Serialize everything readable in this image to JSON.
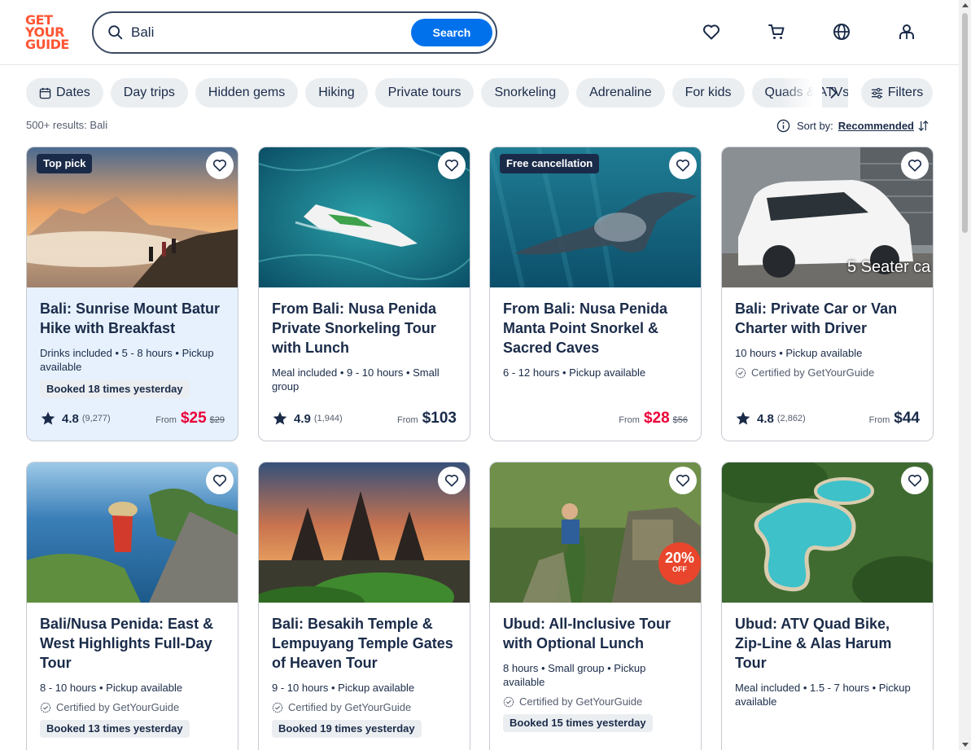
{
  "header": {
    "logo_lines": [
      "GET",
      "YOUR",
      "GUIDE"
    ],
    "search_value": "Bali",
    "search_button": "Search",
    "icons": [
      "heart-icon",
      "cart-icon",
      "globe-icon",
      "account-icon"
    ]
  },
  "chips": [
    {
      "label": "Dates",
      "icon": "calendar-icon"
    },
    {
      "label": "Day trips"
    },
    {
      "label": "Hidden gems"
    },
    {
      "label": "Hiking"
    },
    {
      "label": "Private tours"
    },
    {
      "label": "Snorkeling"
    },
    {
      "label": "Adrenaline"
    },
    {
      "label": "For kids"
    },
    {
      "label": "Quads & ATVs"
    }
  ],
  "filters_label": "Filters",
  "results_text": "500+ results: Bali",
  "sort": {
    "label": "Sort by:",
    "value": "Recommended"
  },
  "cards": [
    {
      "tag": "Top pick",
      "title": "Bali: Sunrise Mount Batur Hike with Breakfast",
      "meta": "Drinks included • 5 - 8 hours • Pickup available",
      "booked": "Booked 18 times yesterday",
      "rating": "4.8",
      "count": "(9,277)",
      "from": "From",
      "price": "$25",
      "old_price": "$29"
    },
    {
      "title": "From Bali: Nusa Penida Private Snorkeling Tour with Lunch",
      "meta": "Meal included • 9 - 10 hours • Small group",
      "rating": "4.9",
      "count": "(1,944)",
      "from": "From",
      "price": "$103"
    },
    {
      "tag": "Free cancellation",
      "title": "From Bali: Nusa Penida Manta Point Snorkel & Sacred Caves",
      "meta": "6 - 12 hours • Pickup available",
      "from": "From",
      "price": "$28",
      "old_price": "$56"
    },
    {
      "title": "Bali: Private Car or Van Charter with Driver",
      "meta": "10 hours • Pickup available",
      "cert": "Certified by GetYourGuide",
      "image_text": "5 Seater ca",
      "rating": "4.8",
      "count": "(2,862)",
      "from": "From",
      "price": "$44"
    },
    {
      "title": "Bali/Nusa Penida: East & West Highlights Full-Day Tour",
      "meta": "8 - 10 hours • Pickup available",
      "cert": "Certified by GetYourGuide",
      "booked": "Booked 13 times yesterday"
    },
    {
      "title": "Bali: Besakih Temple & Lempuyang Temple Gates of Heaven Tour",
      "meta": "9 - 10 hours • Pickup available",
      "cert": "Certified by GetYourGuide",
      "booked": "Booked 19 times yesterday"
    },
    {
      "title": "Ubud: All-Inclusive Tour with Optional Lunch",
      "meta": "8 hours • Small group • Pickup available",
      "cert": "Certified by GetYourGuide",
      "booked": "Booked 15 times yesterday",
      "image_badge": {
        "value": "20%",
        "sub": "OFF"
      }
    },
    {
      "title": "Ubud: ATV Quad Bike, Zip-Line & Alas Harum Tour",
      "meta": "Meal included • 1.5 - 7 hours • Pickup available"
    }
  ],
  "colors": {
    "brand": "#ff5533",
    "accent": "#0071eb",
    "sale": "#eb0037",
    "text": "#1a2b49"
  }
}
